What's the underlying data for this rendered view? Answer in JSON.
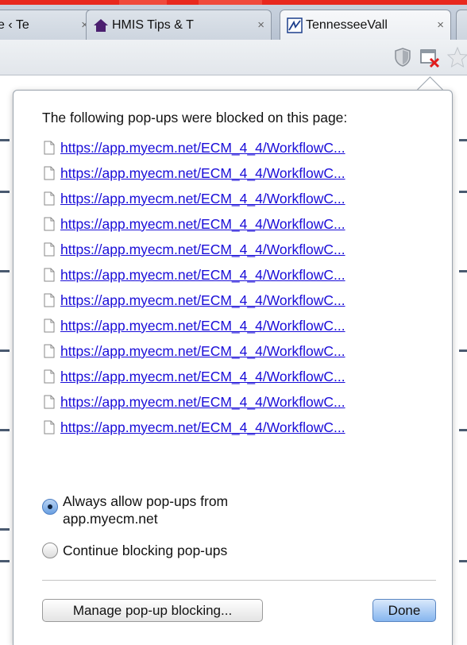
{
  "tabs": [
    {
      "title": "e ‹ Te",
      "close": "×"
    },
    {
      "title": "HMIS Tips & T",
      "close": "×"
    },
    {
      "title": "TennesseeVall",
      "close": "×"
    }
  ],
  "toolbar": {
    "icons": [
      "shield-icon",
      "popup-blocked-icon",
      "star-icon"
    ]
  },
  "popup": {
    "heading": "The following pop-ups were blocked on this page:",
    "links": [
      "https://app.myecm.net/ECM_4_4/WorkflowC...",
      "https://app.myecm.net/ECM_4_4/WorkflowC...",
      "https://app.myecm.net/ECM_4_4/WorkflowC...",
      "https://app.myecm.net/ECM_4_4/WorkflowC...",
      "https://app.myecm.net/ECM_4_4/WorkflowC...",
      "https://app.myecm.net/ECM_4_4/WorkflowC...",
      "https://app.myecm.net/ECM_4_4/WorkflowC...",
      "https://app.myecm.net/ECM_4_4/WorkflowC...",
      "https://app.myecm.net/ECM_4_4/WorkflowC...",
      "https://app.myecm.net/ECM_4_4/WorkflowC...",
      "https://app.myecm.net/ECM_4_4/WorkflowC...",
      "https://app.myecm.net/ECM_4_4/WorkflowC..."
    ],
    "options": {
      "allow_line1": "Always allow pop-ups from",
      "allow_line2": "app.myecm.net",
      "block": "Continue blocking pop-ups",
      "selected": "allow"
    },
    "manage_button": "Manage pop-up blocking...",
    "done_button": "Done"
  },
  "colors": {
    "link": "#1a0dd8",
    "accent": "#e8281e",
    "radio_selected": "#6aa0e2"
  }
}
